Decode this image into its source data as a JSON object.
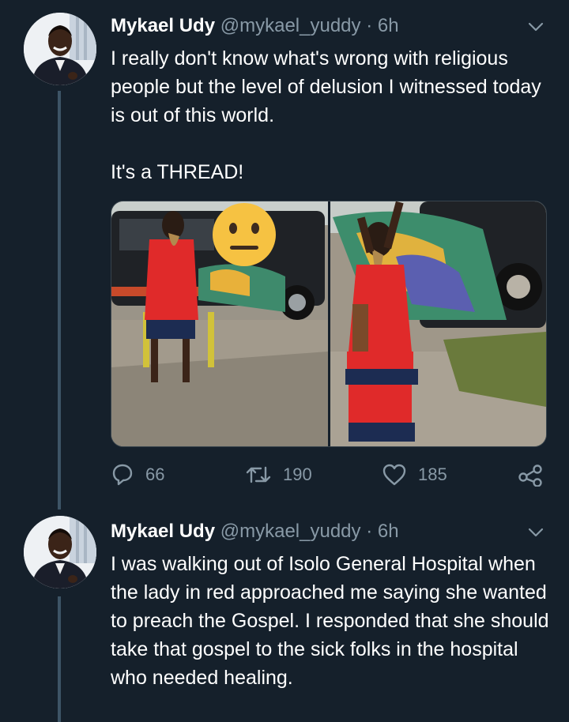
{
  "tweets": [
    {
      "author": {
        "name": "Mykael Udy",
        "handle": "@mykael_yuddy",
        "separator": "·",
        "time": "6h"
      },
      "text_lines": [
        "I really don't know what's wrong with religious people but the level of delusion I witnessed today is out of this world.",
        "It's a THREAD!"
      ],
      "stats": {
        "replies": "66",
        "retweets": "190",
        "likes": "185"
      }
    },
    {
      "author": {
        "name": "Mykael Udy",
        "handle": "@mykael_yuddy",
        "separator": "·",
        "time": "6h"
      },
      "text": "I was walking out of Isolo General Hospital when the lady in red approached me saying she wanted to preach the Gospel. I responded that she should take that gospel to the sick folks in the hospital who needed healing."
    }
  ],
  "icons": {
    "reply": "reply-icon",
    "retweet": "retweet-icon",
    "like": "heart-icon",
    "share": "share-icon",
    "menu": "chevron-down-icon"
  },
  "colors": {
    "background": "#15202b",
    "secondary_text": "#8899a6",
    "thread_line": "#3d5466",
    "border": "#38444d"
  }
}
